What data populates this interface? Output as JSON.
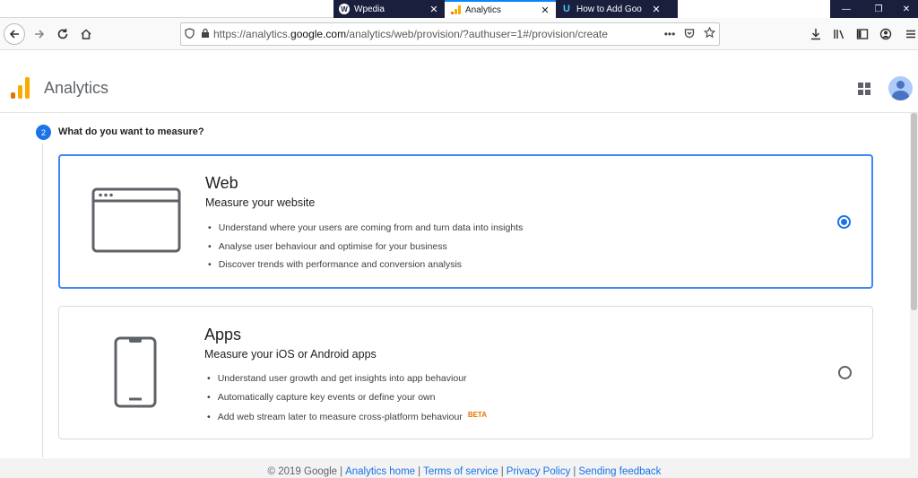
{
  "browser": {
    "tabs": [
      {
        "title": "Wpedia",
        "favicon": "wordpress-icon"
      },
      {
        "title": "Analytics",
        "favicon": "analytics-icon"
      },
      {
        "title": "How to Add Goo",
        "favicon": "u-logo-icon"
      }
    ],
    "close_glyph": "✕",
    "url_prefix": "https://analytics.",
    "url_host": "google.com",
    "url_path": "/analytics/web/provision/?authuser=1#/provision/create",
    "url_more": "•••"
  },
  "app": {
    "name": "Analytics",
    "logo_colors": [
      "#f9ab00",
      "#e37400"
    ]
  },
  "step": {
    "number": "2",
    "title": "What do you want to measure?"
  },
  "options": {
    "web": {
      "title": "Web",
      "subtitle": "Measure your website",
      "bullets": [
        "Understand where your users are coming from and turn data into insights",
        "Analyse user behaviour and optimise for your business",
        "Discover trends with performance and conversion analysis"
      ],
      "selected": true
    },
    "apps": {
      "title": "Apps",
      "subtitle": "Measure your iOS or Android apps",
      "bullets": [
        "Understand user growth and get insights into app behaviour",
        "Automatically capture key events or define your own",
        "Add web stream later to measure cross-platform behaviour"
      ],
      "badge": "BETA",
      "selected": false
    }
  },
  "footer": {
    "copyright": "© 2019 Google",
    "links": [
      "Analytics home",
      "Terms of service",
      "Privacy Policy",
      "Sending feedback"
    ],
    "separator": "|"
  },
  "colors": {
    "accent": "#1a73e8",
    "selected_border": "#4285f4",
    "beta": "#e37400"
  }
}
